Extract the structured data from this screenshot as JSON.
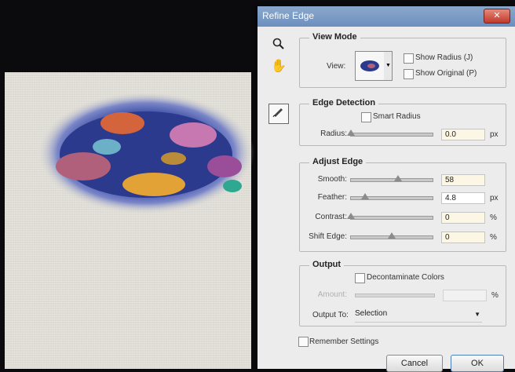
{
  "dialog": {
    "title": "Refine Edge",
    "close_label": "✕"
  },
  "view_mode": {
    "title": "View Mode",
    "view_label": "View:",
    "show_radius_label": "Show Radius (J)",
    "show_original_label": "Show Original (P)"
  },
  "edge_detection": {
    "title": "Edge Detection",
    "smart_radius_label": "Smart Radius",
    "radius_label": "Radius:",
    "radius_value": "0.0",
    "radius_unit": "px",
    "radius_fraction": 0.0
  },
  "adjust_edge": {
    "title": "Adjust Edge",
    "smooth_label": "Smooth:",
    "smooth_value": "58",
    "smooth_fraction": 0.58,
    "feather_label": "Feather:",
    "feather_value": "4.8",
    "feather_unit": "px",
    "feather_fraction": 0.17,
    "contrast_label": "Contrast:",
    "contrast_value": "0",
    "contrast_unit": "%",
    "contrast_fraction": 0.0,
    "shift_label": "Shift Edge:",
    "shift_value": "0",
    "shift_unit": "%",
    "shift_fraction": 0.5
  },
  "output": {
    "title": "Output",
    "decontaminate_label": "Decontaminate Colors",
    "amount_label": "Amount:",
    "amount_unit": "%",
    "output_to_label": "Output To:",
    "output_to_value": "Selection"
  },
  "footer": {
    "remember_label": "Remember Settings",
    "cancel_label": "Cancel",
    "ok_label": "OK"
  },
  "icons": [
    "zoom-icon",
    "hand-icon",
    "refine-radius-brush-icon",
    "dropdown-arrow-icon"
  ]
}
